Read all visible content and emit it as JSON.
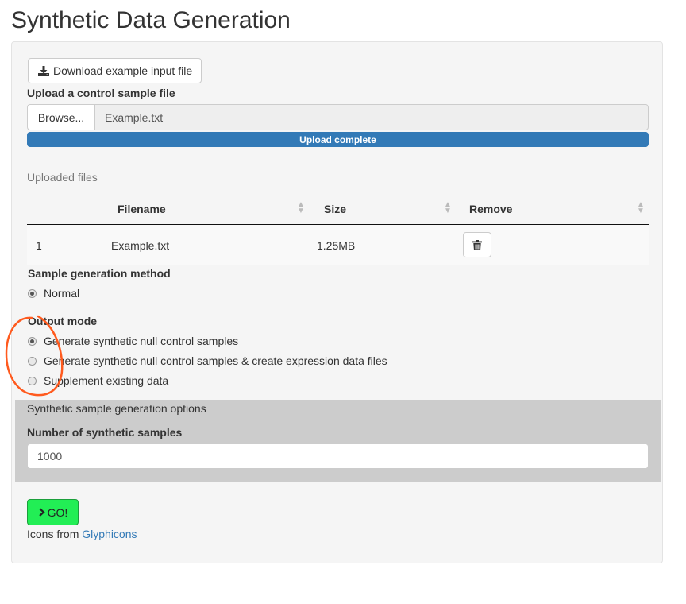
{
  "page": {
    "title": "Synthetic Data Generation"
  },
  "upload": {
    "download_label": "Download example input file",
    "control_label": "Upload a control sample file",
    "browse_label": "Browse...",
    "file_value": "Example.txt",
    "progress_text": "Upload complete",
    "progress_fraction": 1.0
  },
  "files": {
    "caption": "Uploaded files",
    "headers": [
      "Filename",
      "Size",
      "Remove"
    ],
    "rows": [
      {
        "index": "1",
        "filename": "Example.txt",
        "size": "1.25MB"
      }
    ]
  },
  "sample_method": {
    "label": "Sample generation method",
    "options": [
      {
        "label": "Normal",
        "checked": true
      }
    ]
  },
  "output_mode": {
    "label": "Output mode",
    "options": [
      {
        "label": "Generate synthetic null control samples",
        "checked": true
      },
      {
        "label": "Generate synthetic null control samples & create expression data files",
        "checked": false
      },
      {
        "label": "Supplement existing data",
        "checked": false
      }
    ]
  },
  "synthetic_options": {
    "caption": "Synthetic sample generation options",
    "num_label": "Number of synthetic samples",
    "num_value": "1000"
  },
  "go": {
    "label": "GO!"
  },
  "credits": {
    "prefix": "Icons from",
    "link": "Glyphicons"
  },
  "colors": {
    "progress": "#337ab7",
    "go_button": "#22ee55",
    "annotation": "#ff5a1e",
    "options_panel": "#cccccc"
  }
}
